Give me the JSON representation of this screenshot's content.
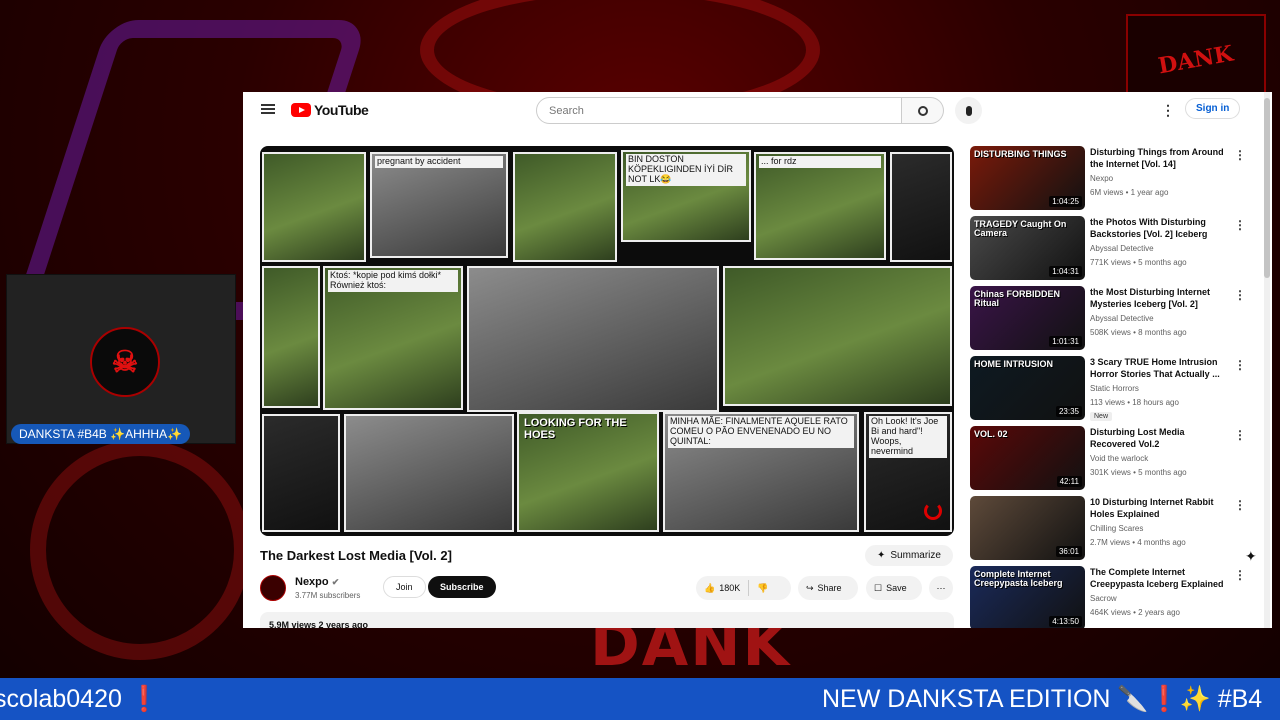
{
  "stream": {
    "cam_tag": "DANKSTA #B4B ✨AHHHA✨",
    "ticker_left": "scolab0420 ❗",
    "ticker_right": "NEW DANKSTA EDITION 🔪❗✨ #B4",
    "logo_text": "DANK"
  },
  "youtube": {
    "logo_text": "YouTube",
    "search_placeholder": "Search",
    "signin_label": "Sign in",
    "video": {
      "title": "The Darkest Lost Media [Vol. 2]",
      "summarize_label": "Summarize",
      "channel": "Nexpo",
      "subscribers": "3.77M subscribers",
      "join_label": "Join",
      "subscribe_label": "Subscribe",
      "likes": "180K",
      "share_label": "Share",
      "save_label": "Save",
      "views_date": "5.9M views  2 years ago",
      "tiles": [
        {
          "caption": "pregnant by accident",
          "style": "light"
        },
        {
          "caption": "BIN DOSTON KÖPEKLIGINDEN İYİ DİR NOT LK😂",
          "style": "light"
        },
        {
          "caption": "... for rdz",
          "style": "light"
        },
        {
          "caption": "Ktoś: *kopie pod kimś dołki* Również ktoś:",
          "style": "light"
        },
        {
          "caption": "LOOKING FOR THE HOES",
          "style": "dark"
        },
        {
          "caption": "MINHA MÃE: FINALMENTE AQUELE RATO COMEU O PÃO ENVENENADO EU NO QUINTAL:",
          "style": "light"
        },
        {
          "caption": "Oh Look! It's Joe Bi and hard\"! Woops, nevermind",
          "style": "light"
        }
      ]
    },
    "recommendations": [
      {
        "title": "Disturbing Things from Around the Internet [Vol. 14]",
        "channel": "Nexpo",
        "meta": "6M views • 1 year ago",
        "duration": "1:04:25",
        "thumb_text": "DISTURBING THINGS",
        "thumb_color": "#7a1a0a",
        "is_new": false
      },
      {
        "title": "the Photos With Disturbing Backstories [Vol. 2] Iceberg",
        "channel": "Abyssal Detective",
        "meta": "771K views • 5 months ago",
        "duration": "1:04:31",
        "thumb_text": "TRAGEDY Caught On Camera",
        "thumb_color": "#4a4a4a",
        "is_new": false
      },
      {
        "title": "the Most Disturbing Internet Mysteries Iceberg [Vol. 2]",
        "channel": "Abyssal Detective",
        "meta": "508K views • 8 months ago",
        "duration": "1:01:31",
        "thumb_text": "Chinas FORBIDDEN Ritual",
        "thumb_color": "#3a1448",
        "is_new": false
      },
      {
        "title": "3 Scary TRUE Home Intrusion Horror Stories That Actually ...",
        "channel": "Static Horrors",
        "meta": "113 views • 18 hours ago",
        "duration": "23:35",
        "thumb_text": "HOME INTRUSION",
        "thumb_color": "#0e1a22",
        "is_new": true,
        "new_label": "New"
      },
      {
        "title": "Disturbing Lost Media Recovered Vol.2",
        "channel": "Void the warlock",
        "meta": "301K views • 5 months ago",
        "duration": "42:11",
        "thumb_text": "VOL. 02",
        "thumb_color": "#5a0808",
        "is_new": false
      },
      {
        "title": "10 Disturbing Internet Rabbit Holes Explained",
        "channel": "Chilling Scares",
        "meta": "2.7M views • 4 months ago",
        "duration": "36:01",
        "thumb_text": "",
        "thumb_color": "#5e4a3a",
        "is_new": false
      },
      {
        "title": "The Complete Internet Creepypasta Iceberg Explained",
        "channel": "Sacrow",
        "meta": "464K views • 2 years ago",
        "duration": "4:13:50",
        "thumb_text": "Complete Internet Creepypasta Iceberg",
        "thumb_color": "#1a2a5a",
        "is_new": false
      }
    ]
  }
}
